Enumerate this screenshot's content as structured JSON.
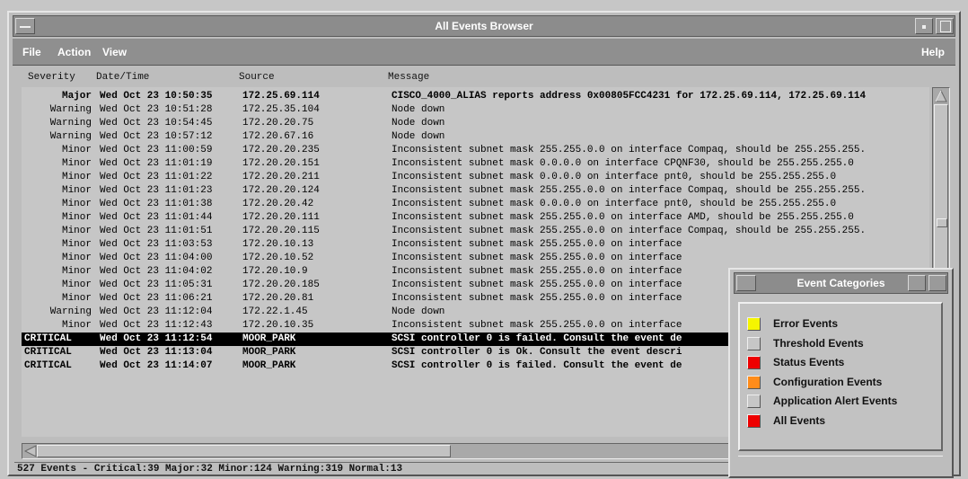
{
  "window": {
    "title": "All Events Browser"
  },
  "menu": {
    "file": "File",
    "action": "Action",
    "view": "View",
    "help": "Help"
  },
  "columns": {
    "severity": "Severity",
    "datetime": "Date/Time",
    "source": "Source",
    "message": "Message"
  },
  "events": [
    {
      "severity": "Major",
      "datetime": "Wed Oct 23 10:50:35",
      "source": "172.25.69.114",
      "message": "CISCO_4000_ALIAS reports address 0x00805FCC4231 for 172.25.69.114, 172.25.69.114"
    },
    {
      "severity": "Warning",
      "datetime": "Wed Oct 23 10:51:28",
      "source": "172.25.35.104",
      "message": "Node down"
    },
    {
      "severity": "Warning",
      "datetime": "Wed Oct 23 10:54:45",
      "source": "172.20.20.75",
      "message": "Node down"
    },
    {
      "severity": "Warning",
      "datetime": "Wed Oct 23 10:57:12",
      "source": "172.20.67.16",
      "message": "Node down"
    },
    {
      "severity": "Minor",
      "datetime": "Wed Oct 23 11:00:59",
      "source": "172.20.20.235",
      "message": "Inconsistent subnet mask 255.255.0.0 on interface Compaq, should be 255.255.255."
    },
    {
      "severity": "Minor",
      "datetime": "Wed Oct 23 11:01:19",
      "source": "172.20.20.151",
      "message": "Inconsistent subnet mask 0.0.0.0 on interface CPQNF30, should be 255.255.255.0"
    },
    {
      "severity": "Minor",
      "datetime": "Wed Oct 23 11:01:22",
      "source": "172.20.20.211",
      "message": "Inconsistent subnet mask 0.0.0.0 on interface pnt0, should be 255.255.255.0"
    },
    {
      "severity": "Minor",
      "datetime": "Wed Oct 23 11:01:23",
      "source": "172.20.20.124",
      "message": "Inconsistent subnet mask 255.255.0.0 on interface Compaq, should be 255.255.255."
    },
    {
      "severity": "Minor",
      "datetime": "Wed Oct 23 11:01:38",
      "source": "172.20.20.42",
      "message": "Inconsistent subnet mask 0.0.0.0 on interface pnt0, should be 255.255.255.0"
    },
    {
      "severity": "Minor",
      "datetime": "Wed Oct 23 11:01:44",
      "source": "172.20.20.111",
      "message": "Inconsistent subnet mask 255.255.0.0 on interface AMD, should be 255.255.255.0"
    },
    {
      "severity": "Minor",
      "datetime": "Wed Oct 23 11:01:51",
      "source": "172.20.20.115",
      "message": "Inconsistent subnet mask 255.255.0.0 on interface Compaq, should be 255.255.255."
    },
    {
      "severity": "Minor",
      "datetime": "Wed Oct 23 11:03:53",
      "source": "172.20.10.13",
      "message": "Inconsistent subnet mask 255.255.0.0 on interface"
    },
    {
      "severity": "Minor",
      "datetime": "Wed Oct 23 11:04:00",
      "source": "172.20.10.52",
      "message": "Inconsistent subnet mask 255.255.0.0 on interface"
    },
    {
      "severity": "Minor",
      "datetime": "Wed Oct 23 11:04:02",
      "source": "172.20.10.9",
      "message": "Inconsistent subnet mask 255.255.0.0 on interface"
    },
    {
      "severity": "Minor",
      "datetime": "Wed Oct 23 11:05:31",
      "source": "172.20.20.185",
      "message": "Inconsistent subnet mask 255.255.0.0 on interface"
    },
    {
      "severity": "Minor",
      "datetime": "Wed Oct 23 11:06:21",
      "source": "172.20.20.81",
      "message": "Inconsistent subnet mask 255.255.0.0 on interface"
    },
    {
      "severity": "Warning",
      "datetime": "Wed Oct 23 11:12:04",
      "source": "172.22.1.45",
      "message": "Node down"
    },
    {
      "severity": "Minor",
      "datetime": "Wed Oct 23 11:12:43",
      "source": "172.20.10.35",
      "message": "Inconsistent subnet mask 255.255.0.0 on interface"
    },
    {
      "severity": "CRITICAL",
      "datetime": "Wed Oct 23 11:12:54",
      "source": "MOOR_PARK",
      "message": "SCSI controller 0 is failed.  Consult the event de"
    },
    {
      "severity": "CRITICAL",
      "datetime": "Wed Oct 23 11:13:04",
      "source": "MOOR_PARK",
      "message": "SCSI controller 0 is Ok.  Consult the event descri"
    },
    {
      "severity": "CRITICAL",
      "datetime": "Wed Oct 23 11:14:07",
      "source": "MOOR_PARK",
      "message": "SCSI controller 0 is failed.  Consult the event de"
    }
  ],
  "status": {
    "text": "527 Events -  Critical:39  Major:32  Minor:124  Warning:319  Normal:13"
  },
  "categories_window": {
    "title": "Event Categories",
    "items": [
      {
        "label": "Error Events",
        "color": "#f5f500"
      },
      {
        "label": "Threshold Events",
        "color": "#c6c6c6"
      },
      {
        "label": "Status Events",
        "color": "#ee0000"
      },
      {
        "label": "Configuration Events",
        "color": "#ff8c1a"
      },
      {
        "label": "Application Alert Events",
        "color": "#c6c6c6"
      },
      {
        "label": "All Events",
        "color": "#ee0000"
      }
    ]
  }
}
